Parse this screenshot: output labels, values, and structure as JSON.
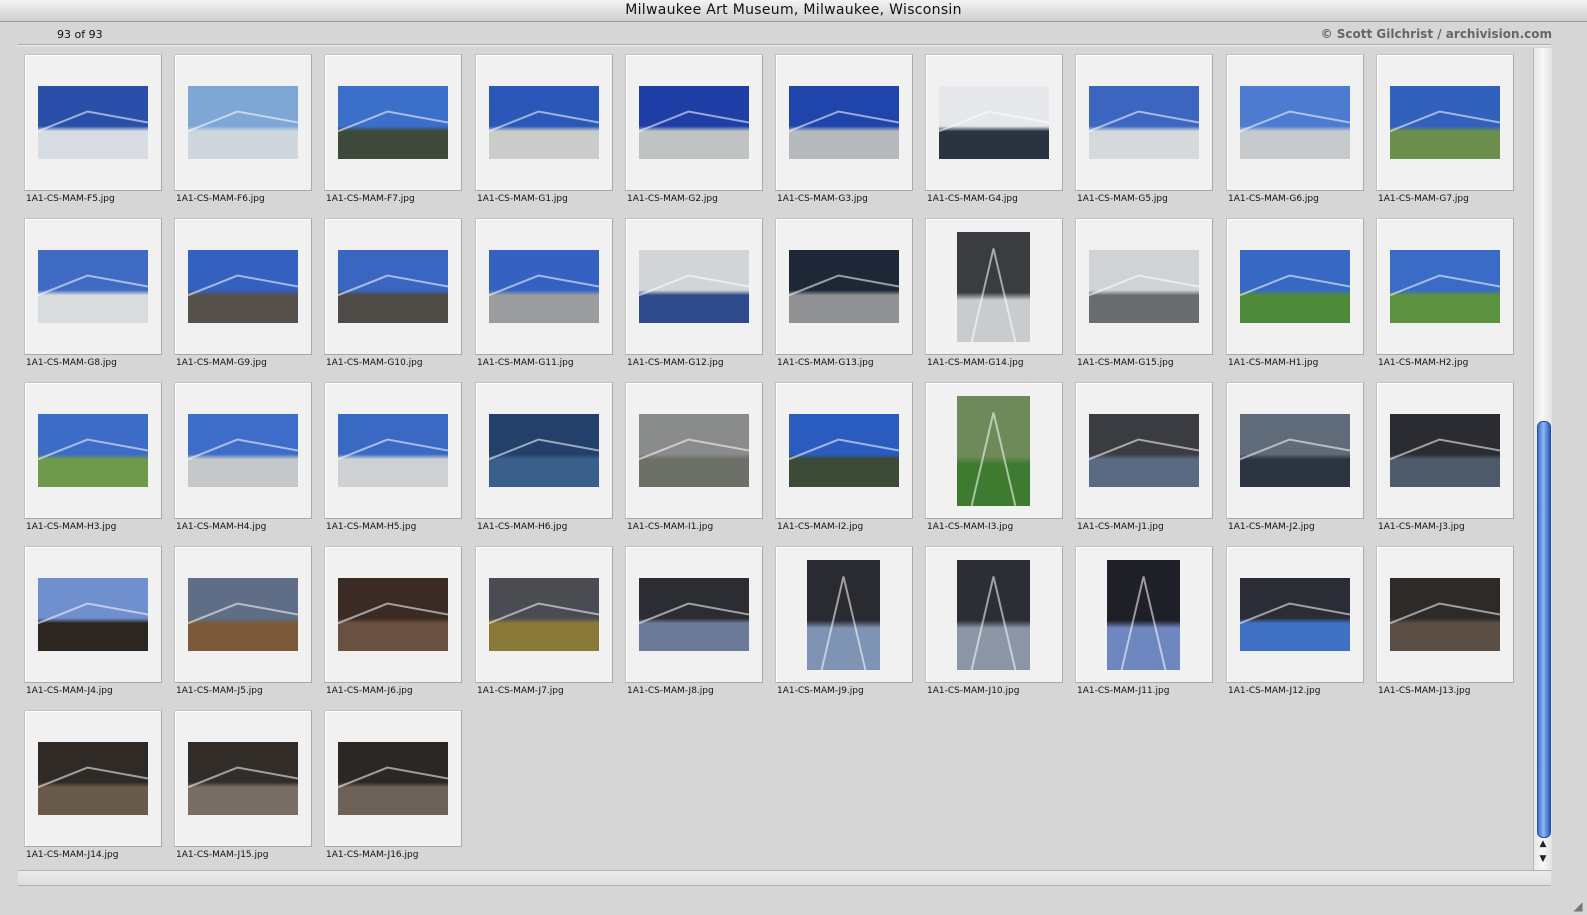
{
  "window": {
    "title": "Milwaukee Art Museum, Milwaukee, Wisconsin",
    "count": "93 of 93",
    "credit": "© Scott Gilchrist / archivision.com"
  },
  "icons": {
    "scroll_up": "triangle-up-icon",
    "scroll_down": "triangle-down-icon",
    "resize": "resize-grip-icon"
  },
  "thumbnails": [
    {
      "file": "1A1-CS-MAM-F5.jpg",
      "orient": "land",
      "top": "#2a4fa8",
      "bottom": "#d8dde3"
    },
    {
      "file": "1A1-CS-MAM-F6.jpg",
      "orient": "land",
      "top": "#7ea7d6",
      "bottom": "#cfd6dc"
    },
    {
      "file": "1A1-CS-MAM-F7.jpg",
      "orient": "land",
      "top": "#3b6fc9",
      "bottom": "#3d4a3a"
    },
    {
      "file": "1A1-CS-MAM-G1.jpg",
      "orient": "land",
      "top": "#2b57b8",
      "bottom": "#c9ccc9"
    },
    {
      "file": "1A1-CS-MAM-G2.jpg",
      "orient": "land",
      "top": "#1f3fa6",
      "bottom": "#bfc3c4"
    },
    {
      "file": "1A1-CS-MAM-G3.jpg",
      "orient": "land",
      "top": "#1f45ad",
      "bottom": "#b6babc"
    },
    {
      "file": "1A1-CS-MAM-G4.jpg",
      "orient": "land",
      "top": "#e5e7ea",
      "bottom": "#2a3440"
    },
    {
      "file": "1A1-CS-MAM-G5.jpg",
      "orient": "land",
      "top": "#3c66c0",
      "bottom": "#d6d9dc"
    },
    {
      "file": "1A1-CS-MAM-G6.jpg",
      "orient": "land",
      "top": "#4d7bd0",
      "bottom": "#c6cacd"
    },
    {
      "file": "1A1-CS-MAM-G7.jpg",
      "orient": "land",
      "top": "#3260bd",
      "bottom": "#6c8f4e"
    },
    {
      "file": "1A1-CS-MAM-G8.jpg",
      "orient": "land",
      "top": "#3f6bc5",
      "bottom": "#d9dcdf"
    },
    {
      "file": "1A1-CS-MAM-G9.jpg",
      "orient": "land",
      "top": "#3461bf",
      "bottom": "#57514c"
    },
    {
      "file": "1A1-CS-MAM-G10.jpg",
      "orient": "land",
      "top": "#3a66c2",
      "bottom": "#4e4a45"
    },
    {
      "file": "1A1-CS-MAM-G11.jpg",
      "orient": "land",
      "top": "#3562c2",
      "bottom": "#9a9c9d"
    },
    {
      "file": "1A1-CS-MAM-G12.jpg",
      "orient": "land",
      "top": "#d2d5d8",
      "bottom": "#2f4a8a"
    },
    {
      "file": "1A1-CS-MAM-G13.jpg",
      "orient": "land",
      "top": "#1d2736",
      "bottom": "#8f9192"
    },
    {
      "file": "1A1-CS-MAM-G14.jpg",
      "orient": "port",
      "top": "#3a3c40",
      "bottom": "#c9ccce"
    },
    {
      "file": "1A1-CS-MAM-G15.jpg",
      "orient": "land",
      "top": "#cfd3d6",
      "bottom": "#6a6d6f"
    },
    {
      "file": "1A1-CS-MAM-H1.jpg",
      "orient": "land",
      "top": "#3768c4",
      "bottom": "#4f8a3a"
    },
    {
      "file": "1A1-CS-MAM-H2.jpg",
      "orient": "land",
      "top": "#3a6bc6",
      "bottom": "#5d9240"
    },
    {
      "file": "1A1-CS-MAM-H3.jpg",
      "orient": "land",
      "top": "#3c6cc6",
      "bottom": "#6f9a4b"
    },
    {
      "file": "1A1-CS-MAM-H4.jpg",
      "orient": "land",
      "top": "#3d6dc8",
      "bottom": "#c4c8cb"
    },
    {
      "file": "1A1-CS-MAM-H5.jpg",
      "orient": "land",
      "top": "#3a69c4",
      "bottom": "#cdd1d4"
    },
    {
      "file": "1A1-CS-MAM-H6.jpg",
      "orient": "land",
      "top": "#23406b",
      "bottom": "#3a5f8a"
    },
    {
      "file": "1A1-CS-MAM-I1.jpg",
      "orient": "land",
      "top": "#8a8c8b",
      "bottom": "#6d6f69"
    },
    {
      "file": "1A1-CS-MAM-I2.jpg",
      "orient": "land",
      "top": "#2a5cc0",
      "bottom": "#3d4a36"
    },
    {
      "file": "1A1-CS-MAM-I3.jpg",
      "orient": "port",
      "top": "#6f8a5a",
      "bottom": "#3e7a2f"
    },
    {
      "file": "1A1-CS-MAM-J1.jpg",
      "orient": "land",
      "top": "#3b3c42",
      "bottom": "#5a6a82"
    },
    {
      "file": "1A1-CS-MAM-J2.jpg",
      "orient": "land",
      "top": "#5f6b78",
      "bottom": "#2c3440"
    },
    {
      "file": "1A1-CS-MAM-J3.jpg",
      "orient": "land",
      "top": "#2a2c31",
      "bottom": "#4c5a6a"
    },
    {
      "file": "1A1-CS-MAM-J4.jpg",
      "orient": "land",
      "top": "#6f8fcf",
      "bottom": "#2c2620"
    },
    {
      "file": "1A1-CS-MAM-J5.jpg",
      "orient": "land",
      "top": "#5f6e86",
      "bottom": "#7a5a3a"
    },
    {
      "file": "1A1-CS-MAM-J6.jpg",
      "orient": "land",
      "top": "#3a2c24",
      "bottom": "#6a5040"
    },
    {
      "file": "1A1-CS-MAM-J7.jpg",
      "orient": "land",
      "top": "#4a4c52",
      "bottom": "#8a7a3a"
    },
    {
      "file": "1A1-CS-MAM-J8.jpg",
      "orient": "land",
      "top": "#2c2d32",
      "bottom": "#6a7a98"
    },
    {
      "file": "1A1-CS-MAM-J9.jpg",
      "orient": "port",
      "top": "#2a2b30",
      "bottom": "#7f93b5"
    },
    {
      "file": "1A1-CS-MAM-J10.jpg",
      "orient": "port",
      "top": "#2b2e35",
      "bottom": "#8a96a6"
    },
    {
      "file": "1A1-CS-MAM-J11.jpg",
      "orient": "port",
      "top": "#1f2027",
      "bottom": "#6f87c0"
    },
    {
      "file": "1A1-CS-MAM-J12.jpg",
      "orient": "land",
      "top": "#2a2d35",
      "bottom": "#3f70c4"
    },
    {
      "file": "1A1-CS-MAM-J13.jpg",
      "orient": "land",
      "top": "#2d2a28",
      "bottom": "#5a4e45"
    },
    {
      "file": "1A1-CS-MAM-J14.jpg",
      "orient": "land",
      "top": "#2f2a26",
      "bottom": "#6a5a4c"
    },
    {
      "file": "1A1-CS-MAM-J15.jpg",
      "orient": "land",
      "top": "#322d29",
      "bottom": "#7a6e64"
    },
    {
      "file": "1A1-CS-MAM-J16.jpg",
      "orient": "land",
      "top": "#2b2724",
      "bottom": "#6e6258"
    }
  ]
}
